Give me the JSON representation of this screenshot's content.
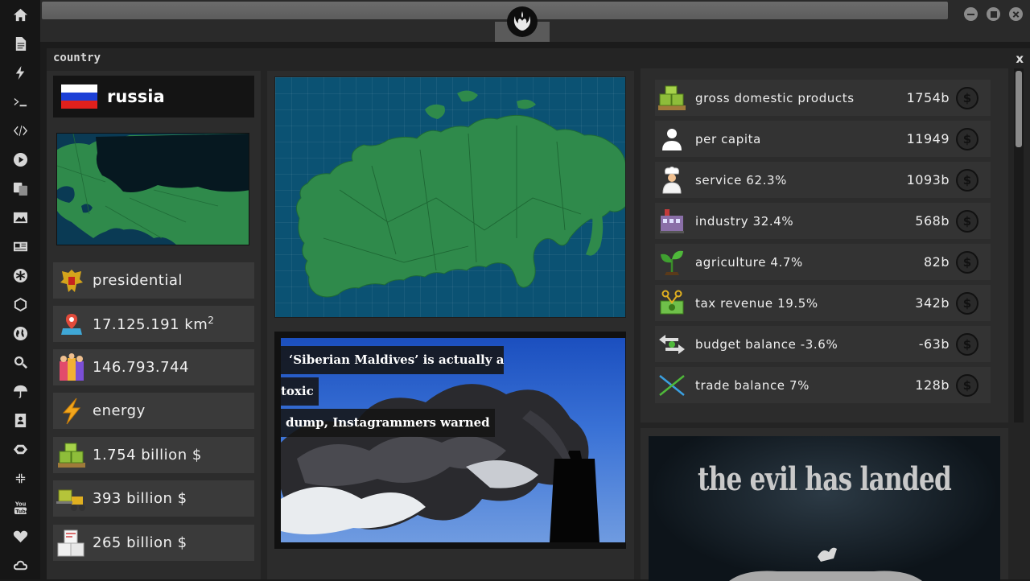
{
  "window": {
    "title": "country",
    "close_label": "x"
  },
  "country": {
    "name": "russia",
    "flag_colors": [
      "#ffffff",
      "#1c3fd6",
      "#e0201c"
    ],
    "government": "presidential",
    "area_number": "17.125.191 km",
    "area_unit_sup": "2",
    "population": "146.793.744",
    "sector": "energy",
    "gdp": "1.754 billion $",
    "budget_value": "393 billion $",
    "export_value": "265 billion $"
  },
  "stats": [
    {
      "label": "gross domestic products",
      "value": "1754b",
      "icon": "money-stack-icon"
    },
    {
      "label": "per capita",
      "value": "11949",
      "icon": "person-icon"
    },
    {
      "label": "service 62.3%",
      "value": "1093b",
      "icon": "chef-icon"
    },
    {
      "label": "industry 32.4%",
      "value": "568b",
      "icon": "factory-icon"
    },
    {
      "label": "agriculture 4.7%",
      "value": "82b",
      "icon": "sprout-icon"
    },
    {
      "label": "tax revenue 19.5%",
      "value": "342b",
      "icon": "cash-scissors-icon"
    },
    {
      "label": "budget balance -3.6%",
      "value": "-63b",
      "icon": "balance-arrows-icon"
    },
    {
      "label": "trade balance 7%",
      "value": "128b",
      "icon": "trade-cross-icon"
    }
  ],
  "stat_button_symbol": "$",
  "news": {
    "line1": "‘Siberian Maldives’ is actually a toxic",
    "line2": "dump, Instagrammers warned"
  },
  "ad": {
    "text": "the evil has landed"
  },
  "colors": {
    "map_land": "#2f8a4b",
    "map_sea": "#0b5273",
    "accent_dark": "#141414"
  },
  "sidebar_icons": [
    "home-icon",
    "document-icon",
    "bolt-icon",
    "terminal-icon",
    "code-icon",
    "play-icon",
    "translate-icon",
    "image-icon",
    "news-icon",
    "asterisk-icon",
    "hexagon-icon",
    "globe-icon",
    "search-icon",
    "umbrella-icon",
    "contact-icon",
    "tag-icon",
    "shrink-icon",
    "youtube-icon",
    "heart-icon",
    "cloud-icon"
  ]
}
